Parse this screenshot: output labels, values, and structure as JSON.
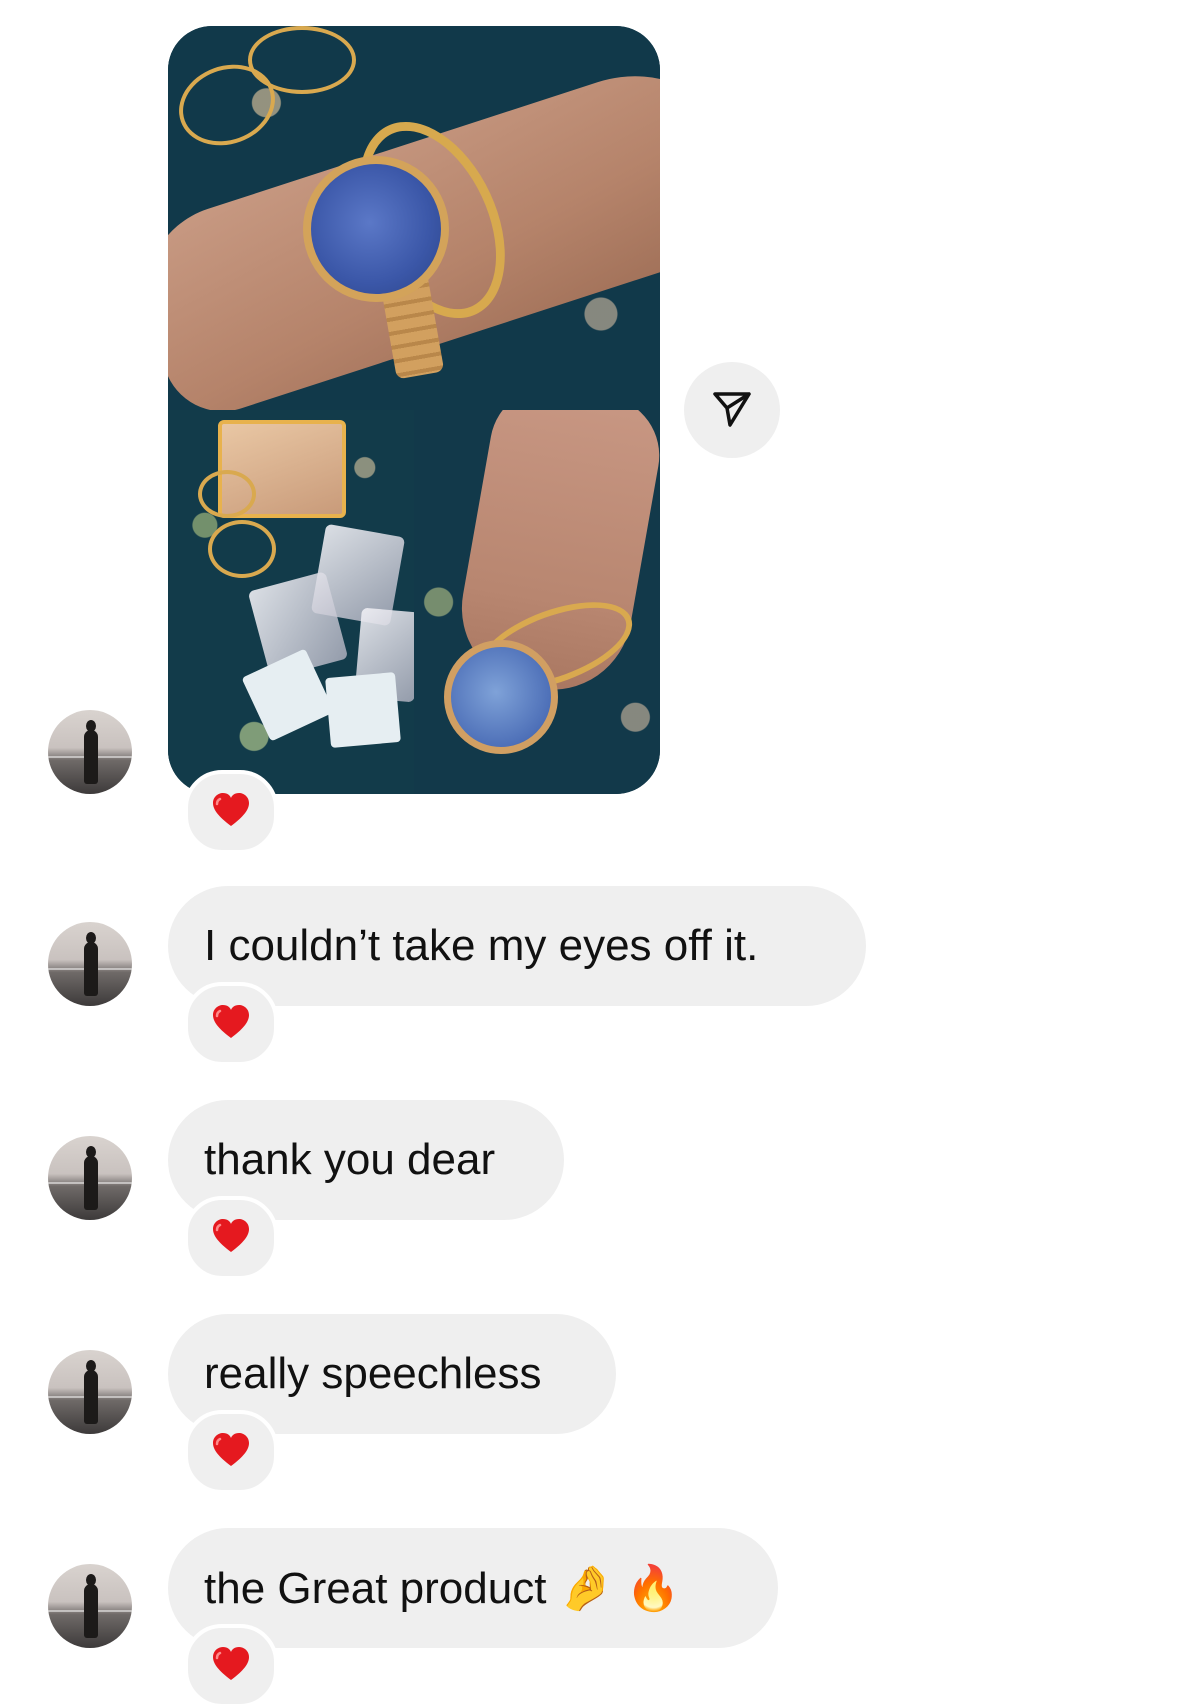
{
  "thread": {
    "media_post": {
      "images": [
        "wrist-watch-bangle",
        "jewelry-pouches",
        "hand-rings-watch"
      ]
    },
    "share_icon": "paper-plane-icon",
    "reaction_icon": "red-heart-icon",
    "messages": [
      {
        "text": "I couldn’t take my eyes off it.",
        "reaction": "❤️"
      },
      {
        "text": "thank you dear",
        "reaction": "❤️"
      },
      {
        "text": "really speechless",
        "reaction": "❤️"
      },
      {
        "text": "the Great product 🤌 🔥",
        "reaction": "❤️"
      }
    ],
    "media_reaction": "❤️"
  },
  "colors": {
    "bubble_bg": "#efefef",
    "heart": "#e5191f",
    "text": "#111111",
    "page_bg": "#ffffff"
  }
}
